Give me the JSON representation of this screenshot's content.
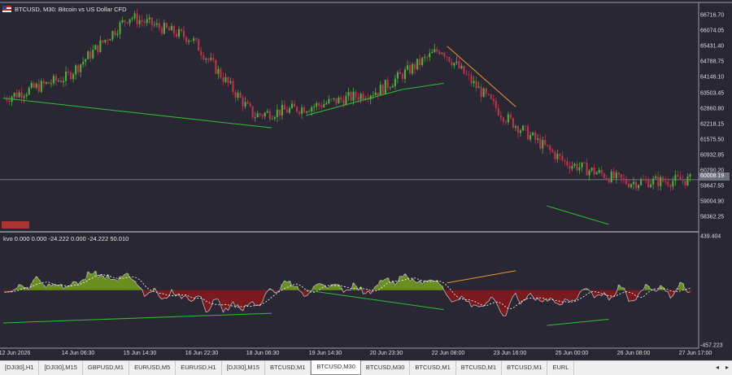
{
  "window": {
    "title": "BTCUSD, M30:  Bitcoin vs US Dollar CFD",
    "indicator_label": "kvo  0.000 0.000 -24.222 0.000 -24.222 50.010"
  },
  "price_axis": {
    "ticks": [
      "66716.70",
      "66074.05",
      "65431.40",
      "64788.75",
      "64146.10",
      "63503.45",
      "62860.80",
      "62218.15",
      "61575.50",
      "60932.85",
      "60290.20",
      "59647.55",
      "59004.90",
      "58362.25"
    ],
    "current_price": "60008.19"
  },
  "indicator_axis": {
    "max": "439.404",
    "min": "-457.223"
  },
  "time_axis": {
    "ticks": [
      "12 Jun 2026",
      "14 Jun 06:30",
      "15 Jun 14:30",
      "16 Jun 22:30",
      "18 Jun 06:30",
      "19 Jun 14:30",
      "20 Jun 23:30",
      "22 Jun 08:00",
      "23 Jun 16:00",
      "25 Jun 00:00",
      "26 Jun 08:00",
      "27 Jun 17:00"
    ]
  },
  "badge": {
    "label": ""
  },
  "tabs": [
    {
      "label": "[DJI30],H1"
    },
    {
      "label": "[DJI30],M15"
    },
    {
      "label": "GBPUSD,M1"
    },
    {
      "label": "EURUSD,M5"
    },
    {
      "label": "EURUSD,H1"
    },
    {
      "label": "[DJI30],M15"
    },
    {
      "label": "BTCUSD,M1"
    },
    {
      "label": "BTCUSD,M30",
      "active": true
    },
    {
      "label": "BTCUSD,M30"
    },
    {
      "label": "BTCUSD,M1"
    },
    {
      "label": "BTCUSD,M1"
    },
    {
      "label": "BTCUSD,M1"
    },
    {
      "label": "EURL"
    }
  ],
  "colors": {
    "background": "#2a2734",
    "bull": "#4fae3a",
    "bear": "#c0304a",
    "divergence_green": "#2fbf2f",
    "divergence_orange": "#e6962e",
    "osc_positive": "#6b8f1f",
    "osc_negative": "#7a1a1e"
  },
  "chart_data": {
    "type": "line",
    "symbol": "BTCUSD",
    "timeframe": "M30",
    "price_series": {
      "x": [
        "12 Jun 2026",
        "14 Jun 06:30",
        "15 Jun 14:30",
        "16 Jun 22:30",
        "18 Jun 06:30",
        "19 Jun 14:30",
        "20 Jun 23:30",
        "22 Jun 08:00",
        "23 Jun 16:00",
        "25 Jun 00:00",
        "26 Jun 08:00",
        "27 Jun 17:00"
      ],
      "y": [
        63300,
        64150,
        66600,
        65700,
        62600,
        63000,
        63600,
        65300,
        62600,
        60700,
        59900,
        60000
      ]
    },
    "ylim": [
      58000,
      67000
    ],
    "indicator": {
      "name": "kvo",
      "ylim": [
        -457.223,
        439.404
      ]
    }
  }
}
